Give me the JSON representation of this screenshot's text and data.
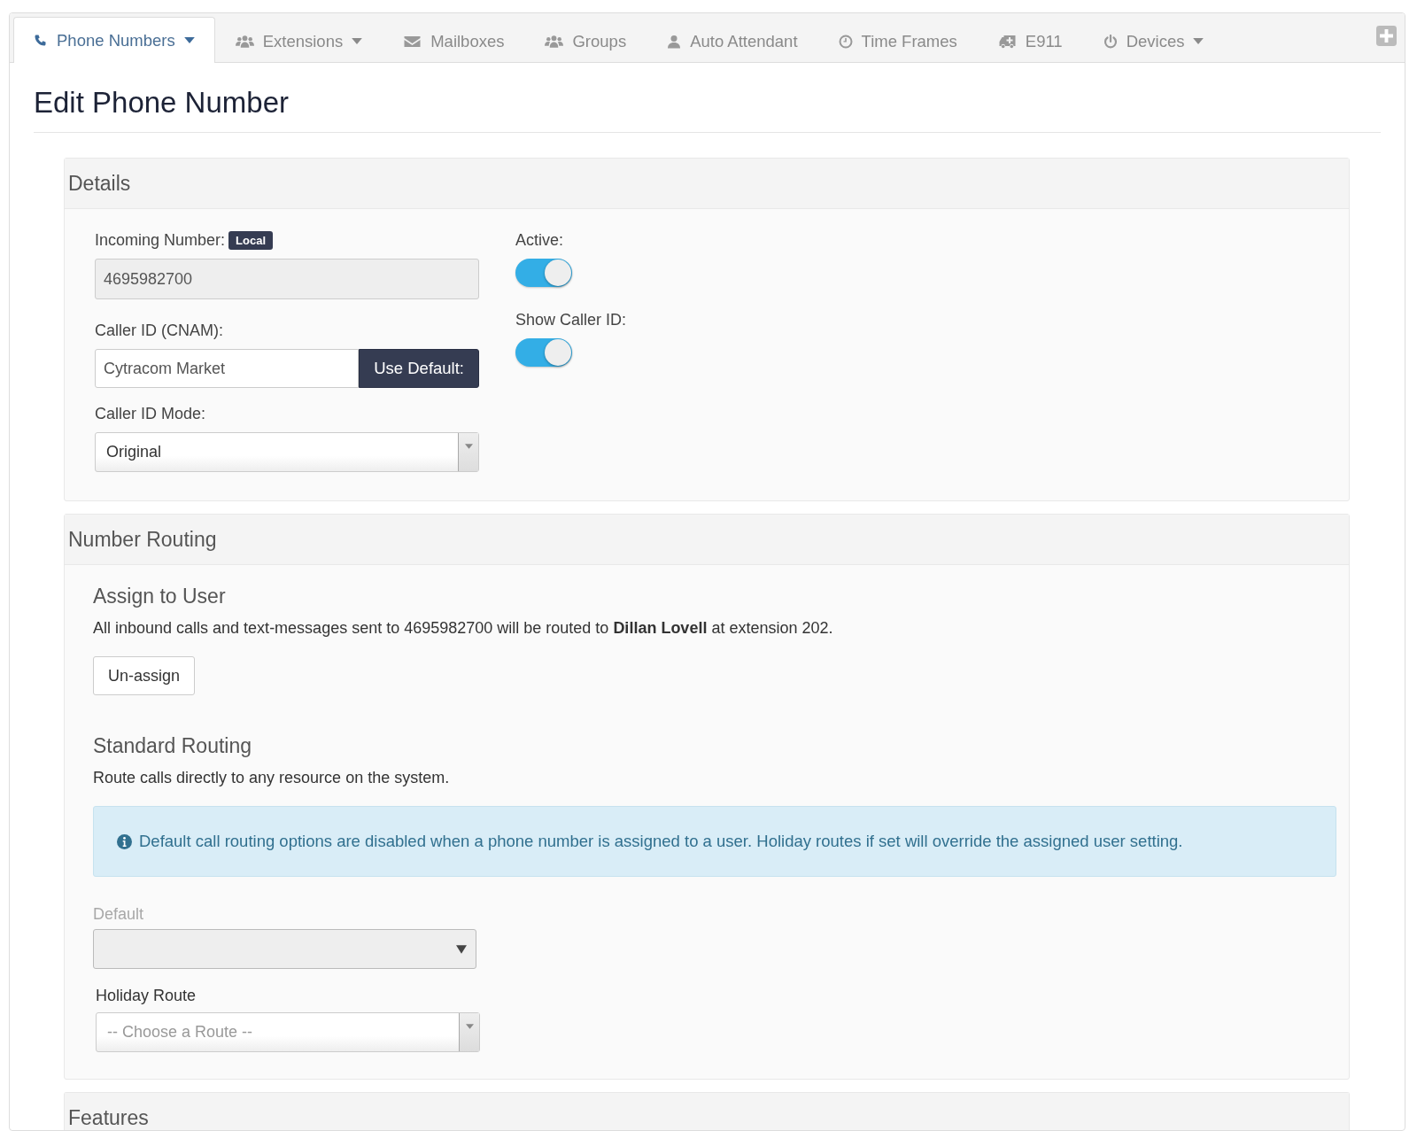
{
  "tabs": [
    {
      "label": "Phone Numbers",
      "selected": true,
      "dropdown": true
    },
    {
      "label": "Extensions",
      "selected": false,
      "dropdown": true
    },
    {
      "label": "Mailboxes",
      "selected": false,
      "dropdown": false
    },
    {
      "label": "Groups",
      "selected": false,
      "dropdown": false
    },
    {
      "label": "Auto Attendant",
      "selected": false,
      "dropdown": false
    },
    {
      "label": "Time Frames",
      "selected": false,
      "dropdown": false
    },
    {
      "label": "E911",
      "selected": false,
      "dropdown": false
    },
    {
      "label": "Devices",
      "selected": false,
      "dropdown": true
    }
  ],
  "page_title": "Edit Phone Number",
  "details": {
    "title": "Details",
    "incoming_number": {
      "label": "Incoming Number:",
      "badge": "Local",
      "value": "4695982700"
    },
    "caller_id": {
      "label": "Caller ID (CNAM):",
      "value": "Cytracom Market",
      "button": "Use Default:"
    },
    "caller_id_mode": {
      "label": "Caller ID Mode:",
      "value": "Original"
    },
    "toggles": [
      {
        "label": "Active:",
        "on": true
      },
      {
        "label": "Show Caller ID:",
        "on": true
      }
    ]
  },
  "number_routing": {
    "title": "Number Routing",
    "assign": {
      "heading": "Assign to User",
      "text": "All inbound calls and text-messages sent to 4695982700 will be routed to **Dillan Lovell** at extension 202.",
      "button": "Un-assign"
    },
    "standard": {
      "heading": "Standard Routing",
      "text": "Route calls directly to any resource on the system.",
      "alert": "Default call routing options are disabled when a phone number is assigned to a user. Holiday routes if set will override the assigned user setting.",
      "default_select": {
        "label": "Default",
        "disabled": true
      },
      "holiday_select": {
        "label": "Holiday Route",
        "placeholder": "-- Choose a Route --"
      }
    }
  },
  "features": {
    "title": "Features"
  }
}
